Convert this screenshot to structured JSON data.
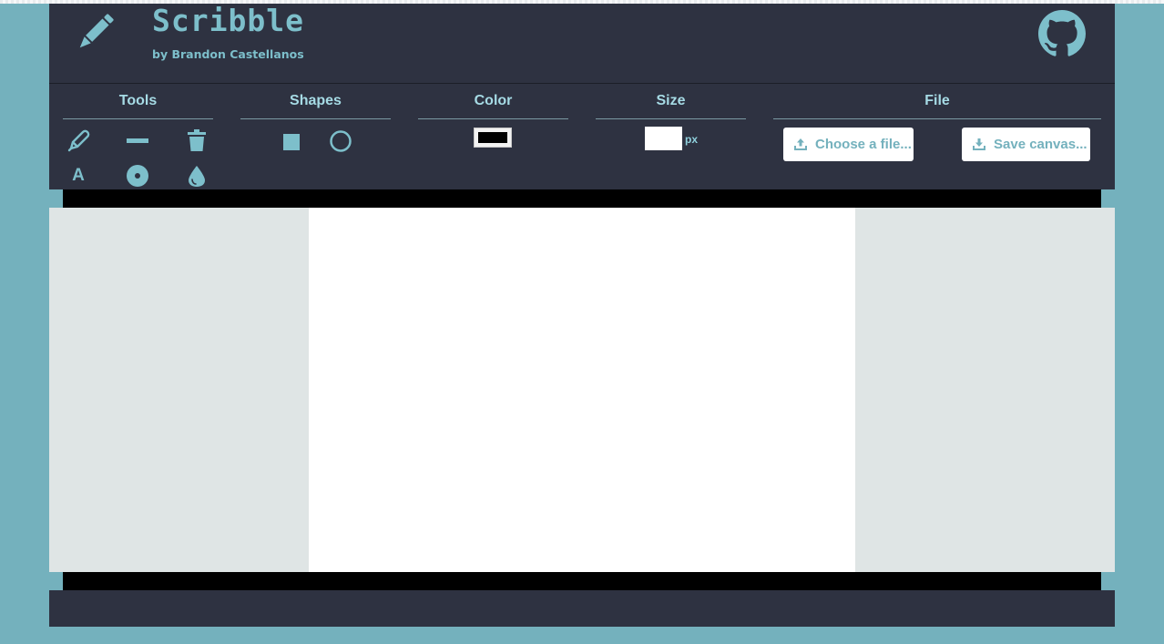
{
  "header": {
    "title": "Scribble",
    "author": "by Brandon Castellanos",
    "logo_icon": "pencil-icon",
    "repo_icon": "github-icon"
  },
  "toolbar": {
    "tools": {
      "title": "Tools",
      "items": [
        {
          "icon": "pencil-tool-icon",
          "label": "pencil"
        },
        {
          "icon": "line-tool-icon",
          "label": "line"
        },
        {
          "icon": "trash-icon",
          "label": "clear"
        },
        {
          "icon": "text-tool-icon",
          "label": "text",
          "glyph": "A"
        },
        {
          "icon": "point-tool-icon",
          "label": "point"
        },
        {
          "icon": "fill-drop-icon",
          "label": "fill"
        }
      ]
    },
    "shapes": {
      "title": "Shapes",
      "items": [
        {
          "icon": "square-shape-icon",
          "label": "square"
        },
        {
          "icon": "circle-shape-icon",
          "label": "circle"
        }
      ]
    },
    "color": {
      "title": "Color",
      "value": "#000000"
    },
    "size": {
      "title": "Size",
      "value": "",
      "unit": "px"
    },
    "file": {
      "title": "File",
      "open_label": "Choose a file...",
      "save_label": "Save canvas..."
    }
  },
  "theme": {
    "accent": "#74b1bd",
    "header_bg": "#2e3241",
    "section_title": "#a6dbe5",
    "canvas_bg": "#ffffff",
    "canvas_surround": "#dfe5e5"
  }
}
